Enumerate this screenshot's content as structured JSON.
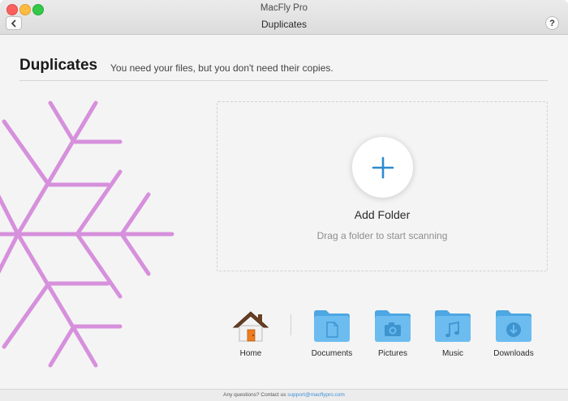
{
  "window": {
    "app_title": "MacFly Pro",
    "nav_title": "Duplicates",
    "help_label": "?"
  },
  "header": {
    "title": "Duplicates",
    "subtitle": "You need your files, but you don't need their copies."
  },
  "dropzone": {
    "action_label": "Add Folder",
    "hint": "Drag a folder to start scanning"
  },
  "shortcuts": [
    {
      "label": "Home",
      "icon": "home-icon"
    },
    {
      "label": "Documents",
      "icon": "documents-folder-icon"
    },
    {
      "label": "Pictures",
      "icon": "pictures-folder-icon"
    },
    {
      "label": "Music",
      "icon": "music-folder-icon"
    },
    {
      "label": "Downloads",
      "icon": "downloads-folder-icon"
    }
  ],
  "footer": {
    "text": "Any questions? Contact us",
    "email": "support@macflypro.com"
  },
  "colors": {
    "accent": "#2f8ad0",
    "snowflake": "#d690dc",
    "folder": "#6cbcf0"
  }
}
